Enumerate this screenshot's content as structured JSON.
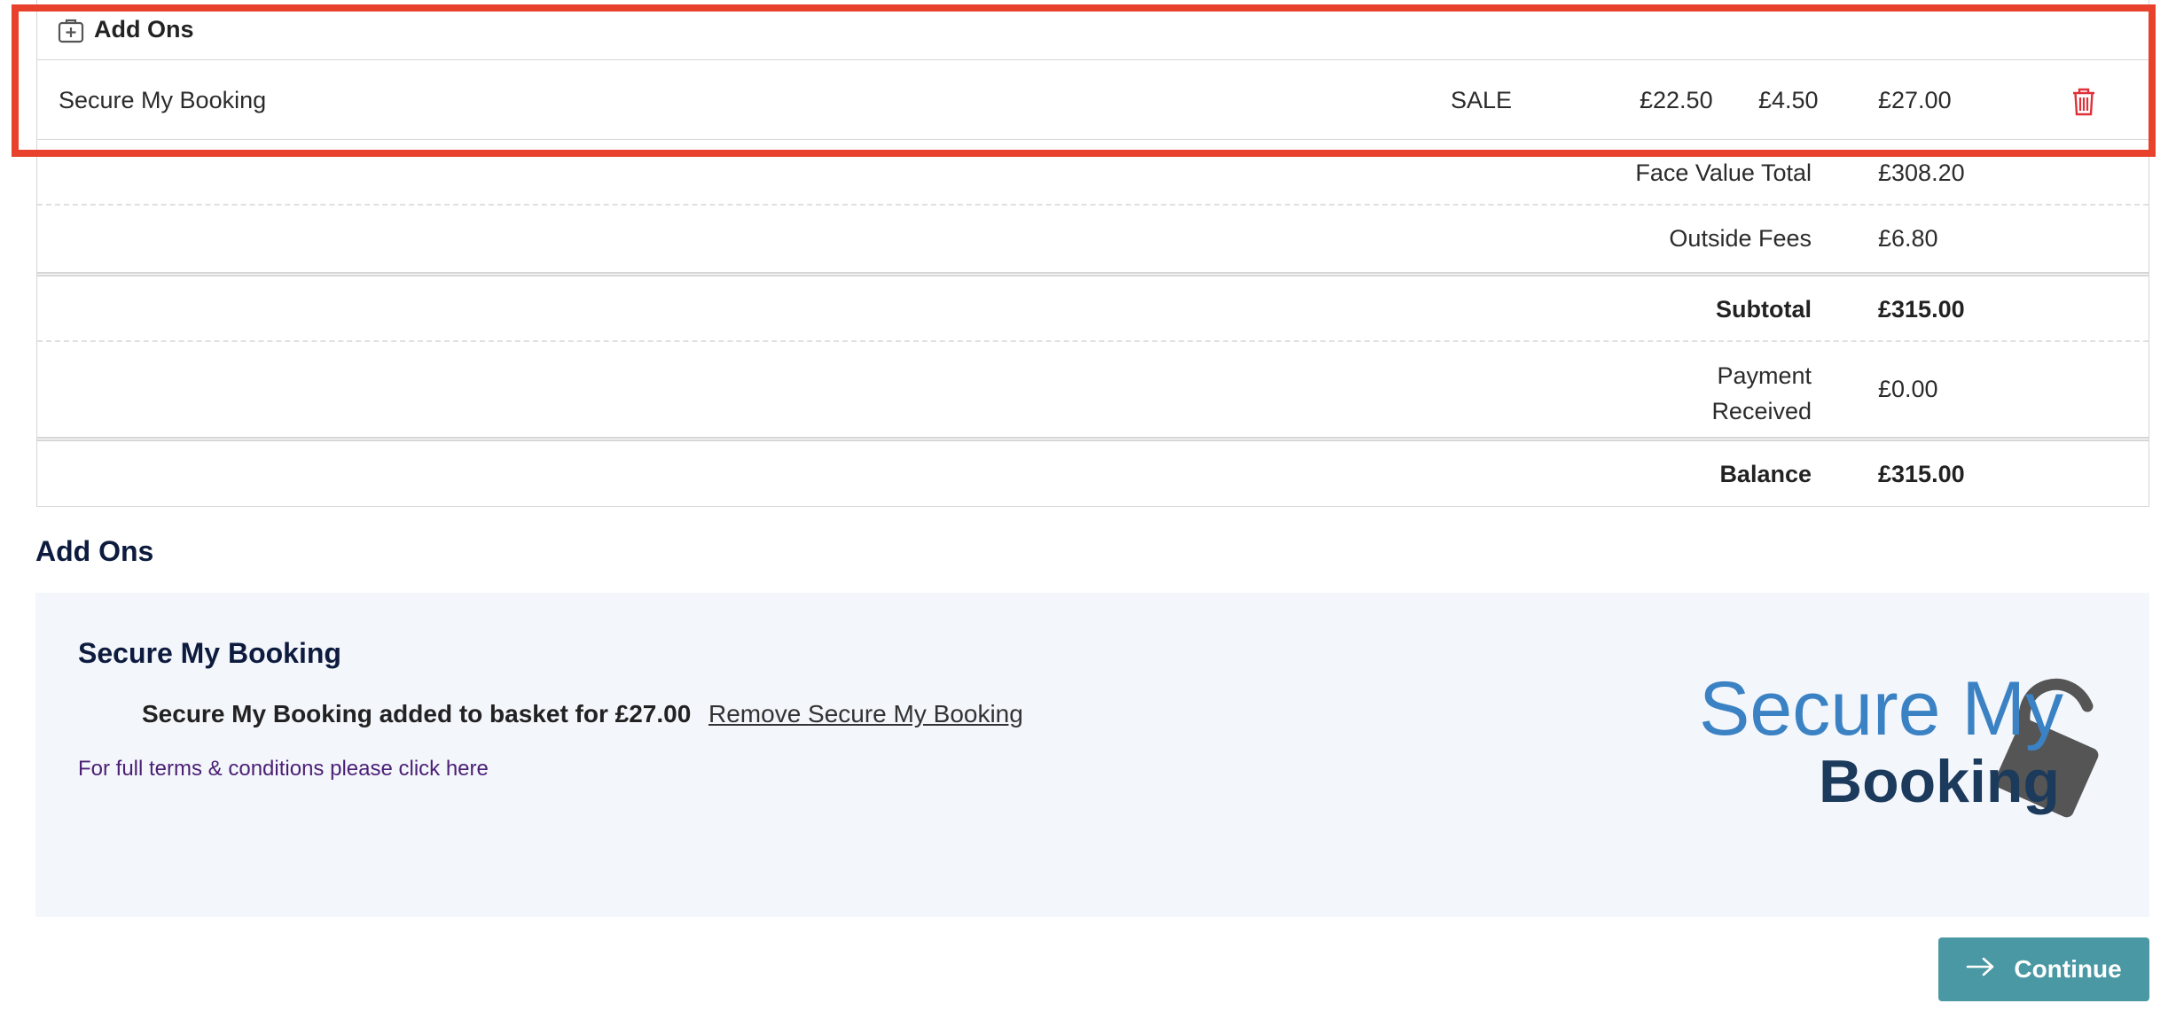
{
  "basket": {
    "addons_header": "Add Ons",
    "item": {
      "name": "Secure My Booking",
      "type": "SALE",
      "price": "£22.50",
      "fee": "£4.50",
      "total": "£27.00"
    },
    "summary": {
      "face_value_label": "Face Value Total",
      "face_value": "£308.20",
      "outside_fees_label": "Outside Fees",
      "outside_fees": "£6.80",
      "subtotal_label": "Subtotal",
      "subtotal": "£315.00",
      "payment_label_line1": "Payment",
      "payment_label_line2": "Received",
      "payment": "£0.00",
      "balance_label": "Balance",
      "balance": "£315.00"
    }
  },
  "addons_section": {
    "title": "Add Ons",
    "card_title": "Secure My Booking",
    "added_message": "Secure My Booking added to basket for £27.00",
    "remove_link": "Remove Secure My Booking",
    "terms_link": "For full terms & conditions please click here",
    "logo": {
      "line1": "Secure My",
      "line2": "Booking",
      "color_primary": "#3b82c4",
      "color_secondary": "#1b3a5c",
      "lock_color": "#555555"
    }
  },
  "footer": {
    "continue_label": "Continue"
  },
  "icons": {
    "addons": "plus-box-icon",
    "delete": "trash-icon",
    "continue": "arrow-right-icon"
  },
  "colors": {
    "highlight": "#e8412c",
    "button": "#4a98a3",
    "panel": "#f3f6fb",
    "delete": "#e0303a",
    "link": "#4b1f75"
  }
}
